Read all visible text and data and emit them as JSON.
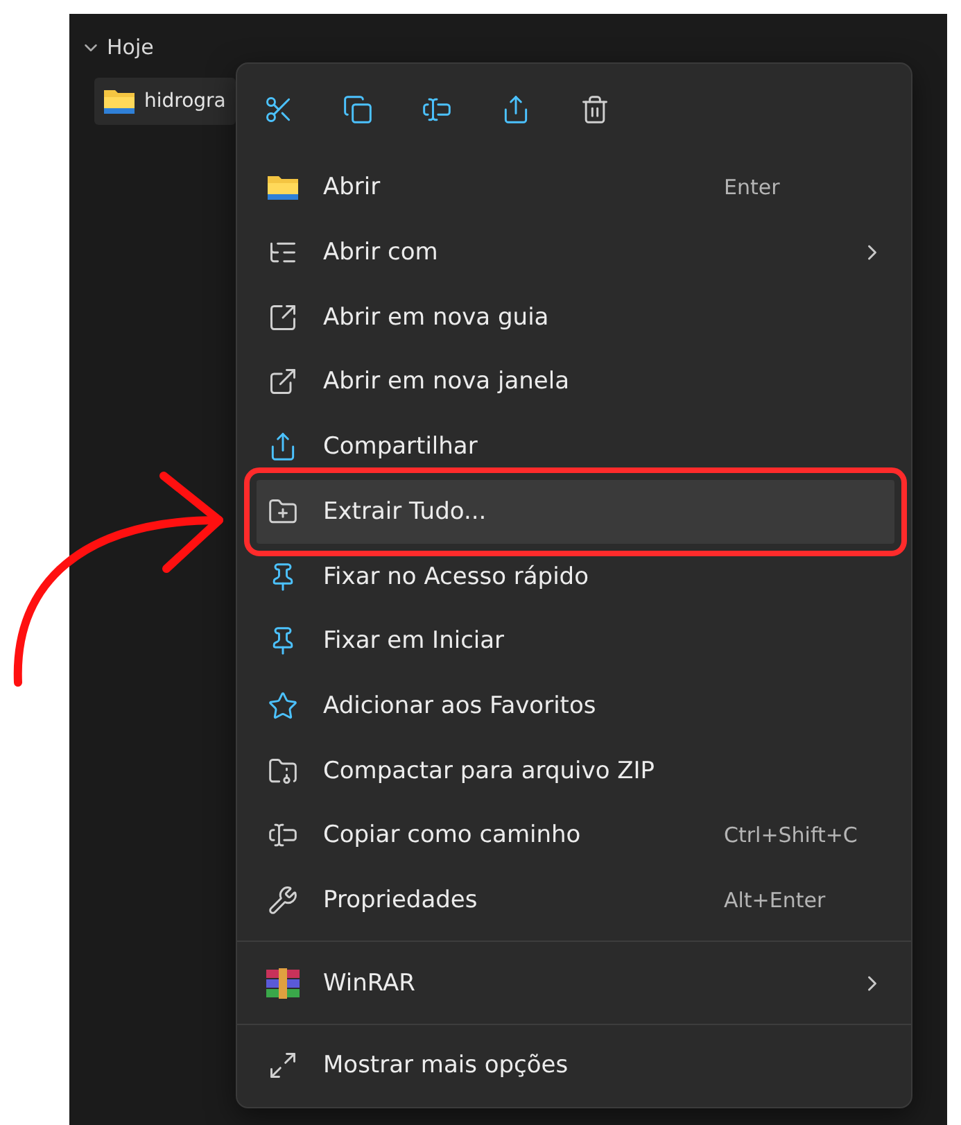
{
  "explorer": {
    "group": {
      "label": "Hoje",
      "expanded": true
    },
    "files": [
      {
        "name": "hidrogra"
      }
    ]
  },
  "menu": {
    "sections": [
      [
        {
          "label": "Abrir",
          "shortcut": "Enter",
          "submenu": false,
          "selected": false
        },
        {
          "label": "Abrir com",
          "submenu": true,
          "selected": false
        },
        {
          "label": "Abrir em nova guia",
          "submenu": false,
          "selected": false
        },
        {
          "label": "Abrir em nova janela",
          "submenu": false,
          "selected": false
        },
        {
          "label": "Compartilhar",
          "submenu": false,
          "selected": false
        },
        {
          "label": "Extrair Tudo...",
          "submenu": false,
          "selected": true
        },
        {
          "label": "Fixar no Acesso rápido",
          "submenu": false,
          "selected": false
        },
        {
          "label": "Fixar em Iniciar",
          "submenu": false,
          "selected": false
        },
        {
          "label": "Adicionar aos Favoritos",
          "submenu": false,
          "selected": false
        },
        {
          "label": "Compactar para arquivo ZIP",
          "submenu": false,
          "selected": false
        },
        {
          "label": "Copiar como caminho",
          "shortcut": "Ctrl+Shift+C",
          "submenu": false,
          "selected": false
        },
        {
          "label": "Propriedades",
          "shortcut": "Alt+Enter",
          "submenu": false,
          "selected": false
        }
      ],
      [
        {
          "label": "WinRAR",
          "submenu": true,
          "selected": false
        }
      ],
      [
        {
          "label": "Mostrar mais opções",
          "submenu": false,
          "selected": false
        }
      ]
    ]
  }
}
